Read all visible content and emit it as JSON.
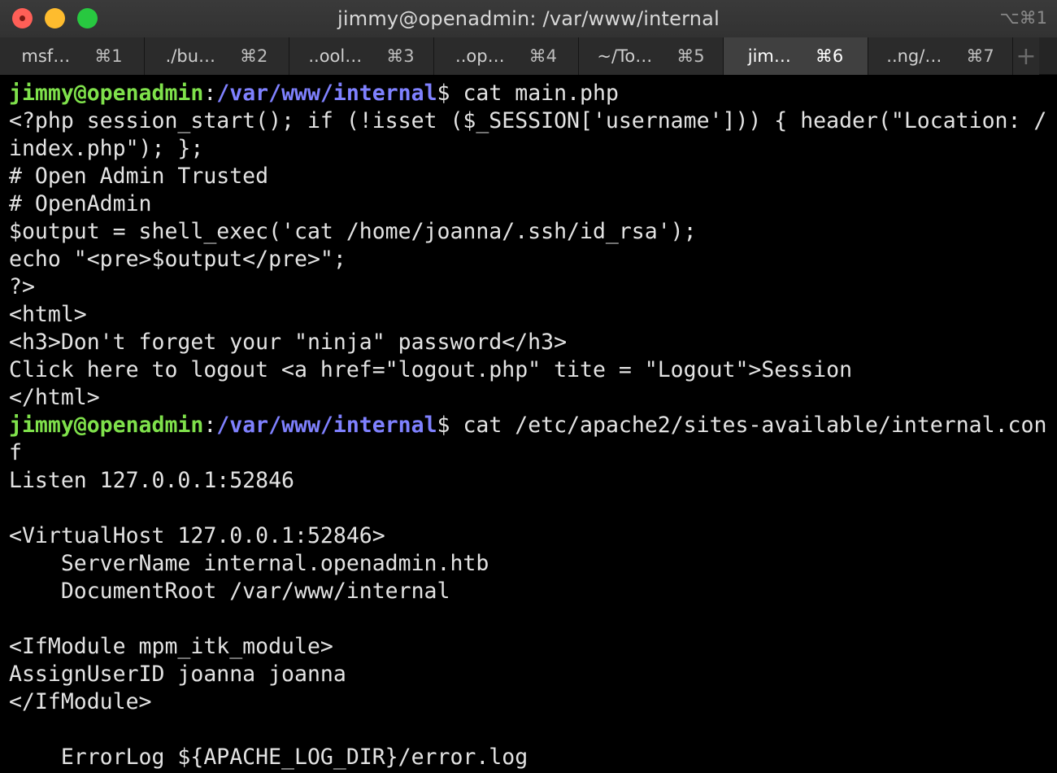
{
  "window": {
    "title": "jimmy@openadmin: /var/www/internal",
    "shortcut": "⌥⌘1"
  },
  "tabs": [
    {
      "label": "msf…",
      "shortcut": "⌘1"
    },
    {
      "label": "./bu…",
      "shortcut": "⌘2"
    },
    {
      "label": "..ool…",
      "shortcut": "⌘3"
    },
    {
      "label": "..op…",
      "shortcut": "⌘4"
    },
    {
      "label": "~/To…",
      "shortcut": "⌘5"
    },
    {
      "label": "jim…",
      "shortcut": "⌘6",
      "active": true
    },
    {
      "label": "..ng/…",
      "shortcut": "⌘7"
    }
  ],
  "tab_add": "+",
  "terminal": {
    "prompt": {
      "user": "jimmy@openadmin",
      "sep": ":",
      "path": "/var/www/internal",
      "symbol": "$"
    },
    "commands": [
      " cat main.php",
      " cat /etc/apache2/sites-available/internal.con"
    ],
    "lines": [
      "<?php session_start(); if (!isset ($_SESSION['username'])) { header(\"Location: /",
      "index.php\"); };",
      "# Open Admin Trusted",
      "# OpenAdmin",
      "$output = shell_exec('cat /home/joanna/.ssh/id_rsa');",
      "echo \"<pre>$output</pre>\";",
      "?>",
      "<html>",
      "<h3>Don't forget your \"ninja\" password</h3>",
      "Click here to logout <a href=\"logout.php\" tite = \"Logout\">Session",
      "</html>",
      "f",
      "Listen 127.0.0.1:52846",
      "",
      "<VirtualHost 127.0.0.1:52846>",
      "    ServerName internal.openadmin.htb",
      "    DocumentRoot /var/www/internal",
      "",
      "<IfModule mpm_itk_module>",
      "AssignUserID joanna joanna",
      "</IfModule>",
      "",
      "    ErrorLog ${APACHE_LOG_DIR}/error.log"
    ]
  },
  "colors": {
    "prompt_user": "#7fe14b",
    "prompt_path": "#7f81ff",
    "text": "#e3e3e3",
    "background": "#000000"
  }
}
